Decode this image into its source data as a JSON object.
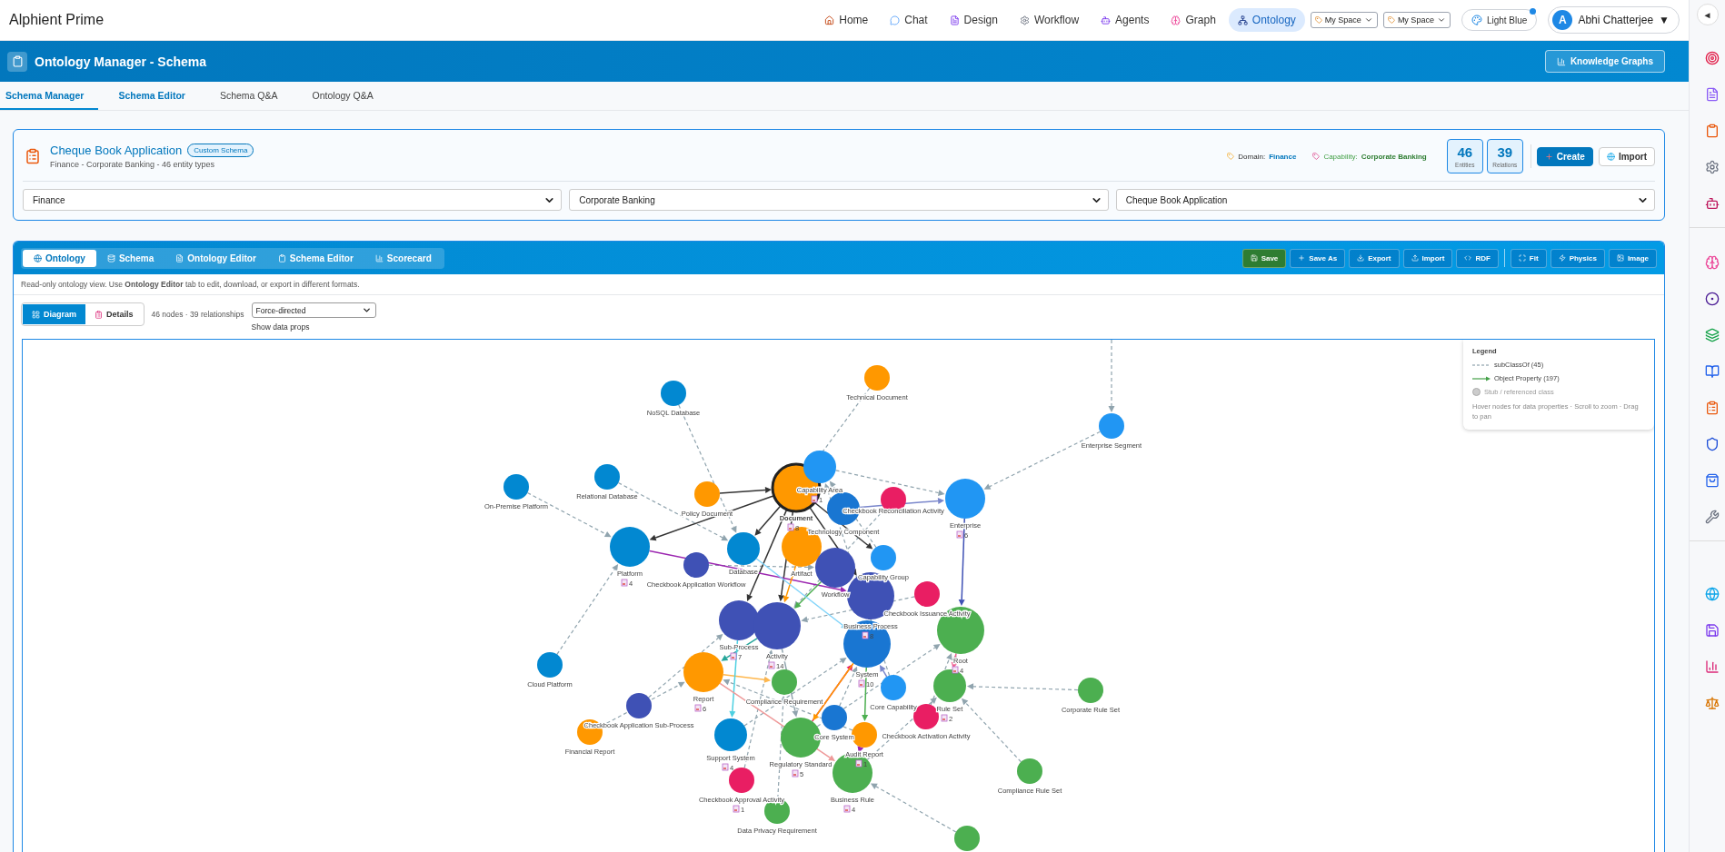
{
  "app": {
    "brand": "Alphient Prime"
  },
  "nav": [
    {
      "label": "Home",
      "selected": false
    },
    {
      "label": "Chat",
      "selected": false
    },
    {
      "label": "Design",
      "selected": false
    },
    {
      "label": "Workflow",
      "selected": false
    },
    {
      "label": "Agents",
      "selected": false
    },
    {
      "label": "Graph",
      "selected": false
    },
    {
      "label": "Ontology",
      "selected": true
    }
  ],
  "space_selects": [
    "My Space",
    "My Space"
  ],
  "theme_button": {
    "label": "Light Blue",
    "notify": true
  },
  "user": {
    "initial": "A",
    "name": "Abhi Chatterjee",
    "caret": "▼"
  },
  "sidebar_toggle": "◄",
  "header": {
    "title": "Ontology Manager - Schema",
    "button": "Knowledge Graphs"
  },
  "tabs": [
    {
      "label": "Schema Manager",
      "selected": true,
      "highlighted": true
    },
    {
      "label": "Schema Editor",
      "selected": false,
      "highlighted": true
    },
    {
      "label": "Schema Q&A",
      "selected": false,
      "highlighted": false
    },
    {
      "label": "Ontology Q&A",
      "selected": false,
      "highlighted": false
    }
  ],
  "schema_card": {
    "title": "Cheque Book Application",
    "badge": "Custom Schema",
    "subtitle": "Finance - Corporate Banking - 46 entity types",
    "domain_label": "Domain:",
    "domain": "Finance",
    "capability_label": "Capability:",
    "capability": "Corporate Banking",
    "stats": [
      {
        "value": "46",
        "label": "Entities"
      },
      {
        "value": "39",
        "label": "Relations"
      }
    ],
    "buttons": [
      {
        "label": "Create",
        "kind": "primary"
      },
      {
        "label": "Import",
        "kind": "secondary"
      }
    ],
    "selects": [
      "Finance",
      "Corporate Banking",
      "Cheque Book Application"
    ]
  },
  "view_tabs": [
    {
      "label": "Ontology",
      "selected": true
    },
    {
      "label": "Schema",
      "selected": false
    },
    {
      "label": "Ontology Editor",
      "selected": false
    },
    {
      "label": "Schema Editor",
      "selected": false
    },
    {
      "label": "Scorecard",
      "selected": false
    }
  ],
  "actions": [
    {
      "label": "Save",
      "kind": "success"
    },
    {
      "label": "Save As",
      "kind": "plain"
    },
    {
      "label": "Export",
      "kind": "plain"
    },
    {
      "label": "Import",
      "kind": "plain"
    },
    {
      "label": "RDF",
      "kind": "plain"
    },
    {
      "label": "Fit",
      "kind": "plain",
      "separated": true
    },
    {
      "label": "Physics",
      "kind": "plain"
    },
    {
      "label": "Image",
      "kind": "plain"
    }
  ],
  "info": "Read-only ontology view. Use **Ontology Editor** tab to edit, download, or export in different formats.",
  "view_toggle": [
    {
      "label": "Diagram",
      "selected": true
    },
    {
      "label": "Details",
      "selected": false
    }
  ],
  "summary": "46 nodes · 39 relationships",
  "layout_select": "Force-directed",
  "data_props_label": "Show data props",
  "legend": {
    "title": "Legend",
    "subclass": "subClassOf (45)",
    "object": "Object Property (197)",
    "stub": "Stub / referenced class",
    "hint": "Hover nodes for data properties · Scroll to zoom · Drag to pan"
  },
  "nodes": [
    {
      "label": "NoSQL Database",
      "color": "#0288d1",
      "selected": false
    },
    {
      "label": "Technical Document",
      "color": "#ff9800",
      "selected": false
    },
    {
      "label": "Enterprise Segment",
      "color": "#2196f3",
      "selected": false
    },
    {
      "label": "On-Premise Platform",
      "color": "#0288d1",
      "selected": false
    },
    {
      "label": "Relational Database",
      "color": "#0288d1",
      "selected": false
    },
    {
      "label": "Policy Document",
      "color": "#ff9800",
      "selected": false
    },
    {
      "label": "Document",
      "color": "#ff9800",
      "selected": true,
      "count": "8"
    },
    {
      "label": "Capability Area",
      "color": "#2196f3",
      "selected": false,
      "count": "1"
    },
    {
      "label": "Technology Component",
      "color": "#1976d2",
      "selected": false
    },
    {
      "label": "Checkbook Reconciliation Activity",
      "color": "#e91e63",
      "selected": false
    },
    {
      "label": "Enterprise",
      "color": "#2196f3",
      "selected": false,
      "count": "6"
    },
    {
      "label": "Platform",
      "color": "#0288d1",
      "selected": false,
      "count": "4"
    },
    {
      "label": "Database",
      "color": "#0288d1",
      "selected": false
    },
    {
      "label": "Checkbook Application Workflow",
      "color": "#3f51b5",
      "selected": false
    },
    {
      "label": "Artifact",
      "color": "#ff9800",
      "selected": false
    },
    {
      "label": "Workflow",
      "color": "#3f51b5",
      "selected": false
    },
    {
      "label": "Capability Group",
      "color": "#2196f3",
      "selected": false
    },
    {
      "label": "Sub-Process",
      "color": "#3f51b5",
      "selected": false,
      "count": "7"
    },
    {
      "label": "Activity",
      "color": "#3f51b5",
      "selected": false,
      "count": "14"
    },
    {
      "label": "Business Process",
      "color": "#3f51b5",
      "selected": false,
      "count": "8"
    },
    {
      "label": "Checkbook Issuance Activity",
      "color": "#e91e63",
      "selected": false
    },
    {
      "label": "Cloud Platform",
      "color": "#0288d1",
      "selected": false
    },
    {
      "label": "Report",
      "color": "#ff9800",
      "selected": false,
      "count": "6"
    },
    {
      "label": "System",
      "color": "#1976d2",
      "selected": false,
      "count": "10"
    },
    {
      "label": "Root",
      "color": "#4caf50",
      "selected": false,
      "count": "4"
    },
    {
      "label": "Checkbook Application Sub-Process",
      "color": "#3f51b5",
      "selected": false
    },
    {
      "label": "Compliance Requirement",
      "color": "#4caf50",
      "selected": false
    },
    {
      "label": "Core Capability",
      "color": "#2196f3",
      "selected": false
    },
    {
      "label": "Rule Set",
      "color": "#4caf50",
      "selected": false,
      "count": "2"
    },
    {
      "label": "Corporate Rule Set",
      "color": "#4caf50",
      "selected": false
    },
    {
      "label": "Financial Report",
      "color": "#ff9800",
      "selected": false
    },
    {
      "label": "Support System",
      "color": "#0288d1",
      "selected": false,
      "count": "4"
    },
    {
      "label": "Regulatory Standard",
      "color": "#4caf50",
      "selected": false,
      "count": "5"
    },
    {
      "label": "Core System",
      "color": "#1976d2",
      "selected": false
    },
    {
      "label": "Audit Report",
      "color": "#ff9800",
      "selected": false,
      "count": "1"
    },
    {
      "label": "Checkbook Activation Activity",
      "color": "#e91e63",
      "selected": false
    },
    {
      "label": "Checkbook Approval Activity",
      "color": "#e91e63",
      "selected": false,
      "count": "1"
    },
    {
      "label": "Business Rule",
      "color": "#4caf50",
      "selected": false,
      "count": "4"
    },
    {
      "label": "Compliance Rule Set",
      "color": "#4caf50",
      "selected": false
    },
    {
      "label": "Data Privacy Requirement",
      "color": "#4caf50",
      "selected": false
    },
    {
      "color": "#4caf50",
      "selected": false
    }
  ]
}
